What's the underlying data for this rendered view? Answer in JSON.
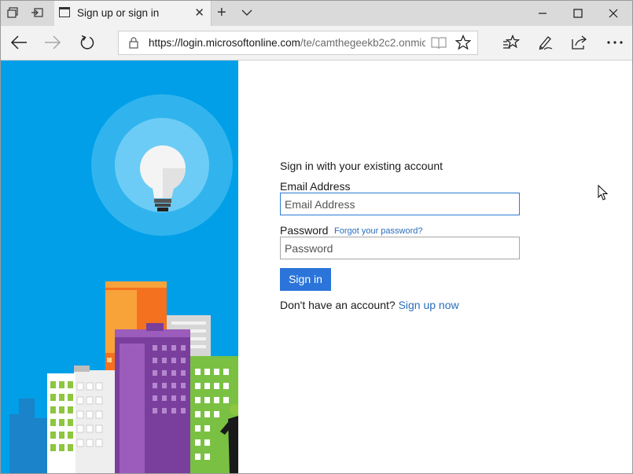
{
  "browser": {
    "tab_title": "Sign up or sign in",
    "url_host": "https://login.microsoftonline.com",
    "url_rest": "/te/camthegeekb2c2.onmic"
  },
  "form": {
    "heading": "Sign in with your existing account",
    "email_label": "Email Address",
    "email_placeholder": "Email Address",
    "password_label": "Password",
    "forgot_link": "Forgot your password?",
    "password_placeholder": "Password",
    "signin_button": "Sign in",
    "no_account_text": "Don't have an account?",
    "signup_link": "Sign up now"
  },
  "colors": {
    "accent": "#2b74d9",
    "link": "#2a6ebb",
    "illustration_bg": "#009fe8"
  },
  "icons": [
    "tab-actions-icon",
    "set-aside-tabs-icon",
    "page-icon",
    "close-icon",
    "plus-icon",
    "chevron-down-icon",
    "minimize-icon",
    "maximize-icon",
    "back-icon",
    "forward-icon",
    "refresh-icon",
    "lock-icon",
    "reading-view-icon",
    "favorite-star-icon",
    "favorites-hub-icon",
    "pen-icon",
    "share-icon",
    "more-icon",
    "lightbulb-icon",
    "mouse-cursor-icon"
  ]
}
